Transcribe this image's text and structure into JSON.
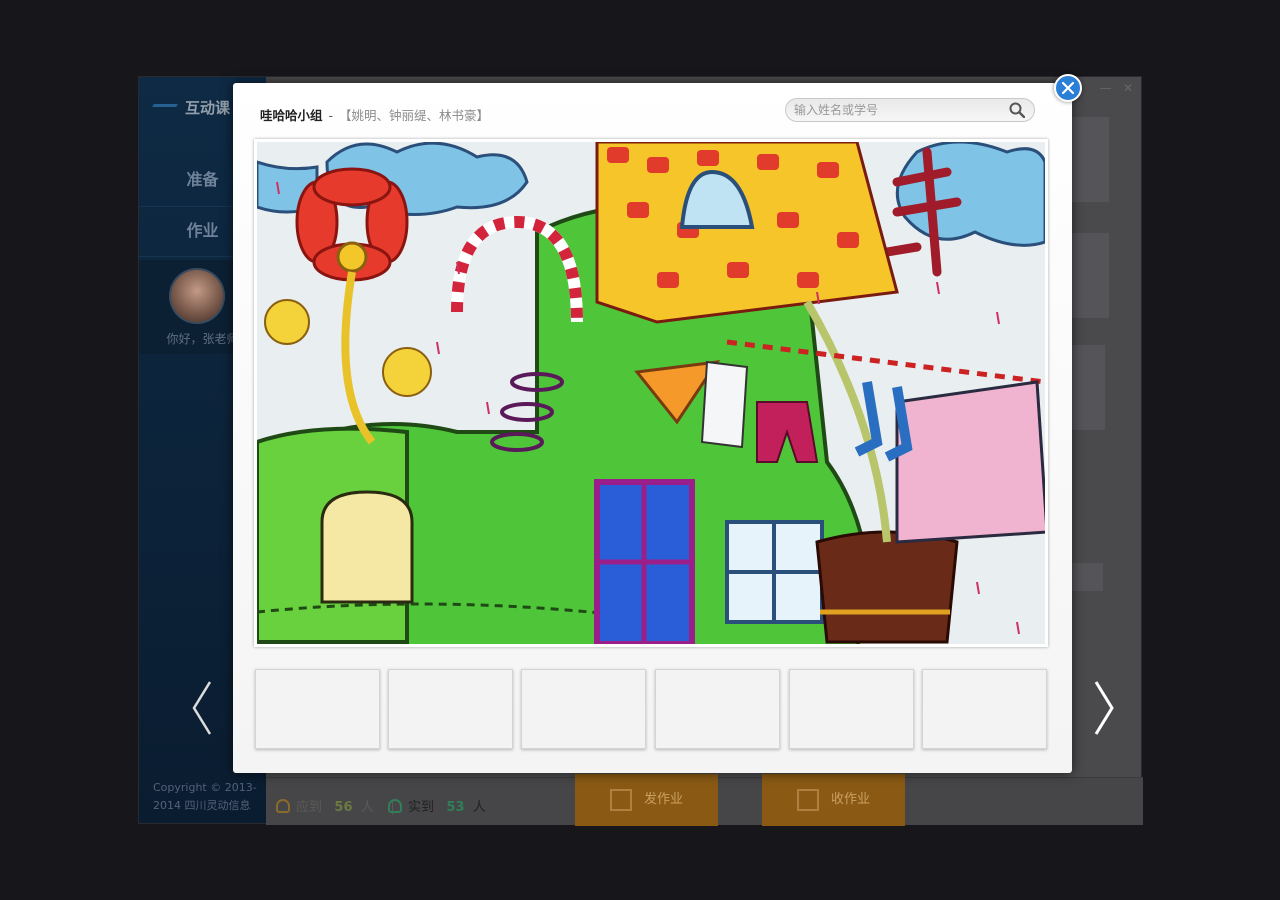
{
  "app": {
    "logo_text": "互动课",
    "nav": [
      {
        "label": "准备"
      },
      {
        "label": "作业"
      }
    ],
    "user": {
      "greeting": "你好，张老师"
    },
    "copyright": "Copyright © 2013-2014 四川灵动信息",
    "stats": {
      "expected_label": "应到",
      "expected_count": "56",
      "expected_unit": "人",
      "divider": "|",
      "actual_label": "实到",
      "actual_count": "53",
      "actual_unit": "人"
    },
    "buttons": {
      "assign_label": "发作业",
      "collect_label": "收作业"
    }
  },
  "modal": {
    "group_name": "哇哈哈小组",
    "separator": "-",
    "members": "【姚明、钟丽缇、林书豪】",
    "search_placeholder": "输入姓名或学号",
    "thumbnails": [
      {},
      {},
      {},
      {},
      {},
      {}
    ],
    "accent_color": "#2b7fd6"
  }
}
